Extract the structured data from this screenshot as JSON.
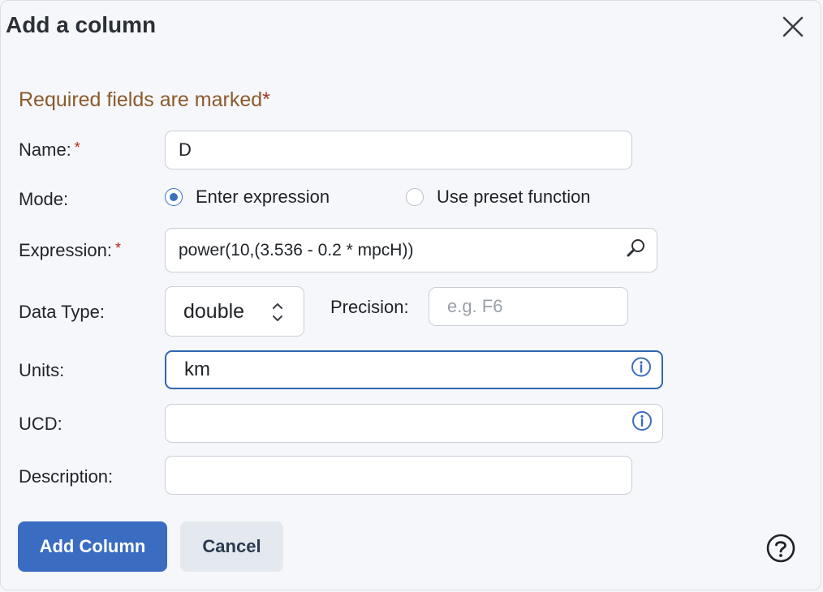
{
  "dialog": {
    "title": "Add a column",
    "required_note": "Required fields are marked",
    "required_marker": "*"
  },
  "fields": {
    "name": {
      "label": "Name:",
      "value": "D"
    },
    "mode": {
      "label": "Mode:",
      "options": [
        {
          "label": "Enter expression",
          "selected": true
        },
        {
          "label": "Use preset function",
          "selected": false
        }
      ]
    },
    "expression": {
      "label": "Expression:",
      "value": "power(10,(3.536 - 0.2 * mpcH))"
    },
    "data_type": {
      "label": "Data Type:",
      "value": "double"
    },
    "precision": {
      "label": "Precision:",
      "placeholder": "e.g. F6"
    },
    "units": {
      "label": "Units:",
      "value": "km"
    },
    "ucd": {
      "label": "UCD:",
      "value": ""
    },
    "description": {
      "label": "Description:",
      "value": ""
    }
  },
  "buttons": {
    "add": "Add Column",
    "cancel": "Cancel"
  },
  "icons": {
    "close": "close-icon",
    "search": "search-icon",
    "info": "info-icon",
    "help": "help-icon",
    "select_arrows": "chevron-up-down-icon"
  },
  "colors": {
    "accent": "#3a6cc2",
    "required_note": "#8a5a2b",
    "required_star": "#b3261e"
  }
}
